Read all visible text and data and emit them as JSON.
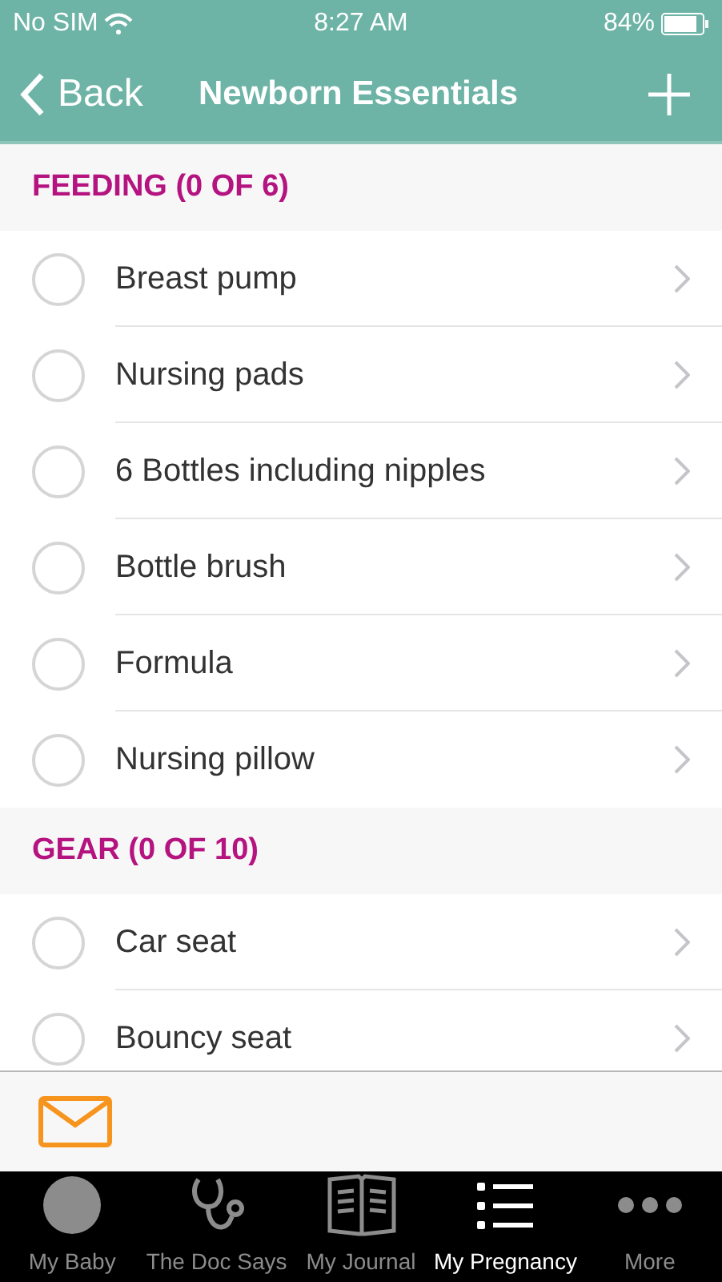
{
  "status_bar": {
    "carrier": "No SIM",
    "time": "8:27 AM",
    "battery": "84%"
  },
  "nav": {
    "back": "Back",
    "title": "Newborn Essentials"
  },
  "sections": [
    {
      "title": "FEEDING (0 OF 6)",
      "items": [
        {
          "label": "Breast pump",
          "checked": false
        },
        {
          "label": "Nursing pads",
          "checked": false
        },
        {
          "label": "6 Bottles including nipples",
          "checked": false
        },
        {
          "label": "Bottle brush",
          "checked": false
        },
        {
          "label": "Formula",
          "checked": false
        },
        {
          "label": "Nursing pillow",
          "checked": false
        }
      ]
    },
    {
      "title": "GEAR (0 OF 10)",
      "items": [
        {
          "label": "Car seat",
          "checked": false
        },
        {
          "label": "Bouncy seat",
          "checked": false
        }
      ]
    }
  ],
  "tabs": [
    {
      "kind": "baby",
      "label": "My Baby",
      "selected": false
    },
    {
      "kind": "doc",
      "label": "The Doc Says",
      "selected": false
    },
    {
      "kind": "journal",
      "label": "My Journal",
      "selected": false
    },
    {
      "kind": "list",
      "label": "My Pregnancy",
      "selected": true
    },
    {
      "kind": "more",
      "label": "More",
      "selected": false
    }
  ]
}
